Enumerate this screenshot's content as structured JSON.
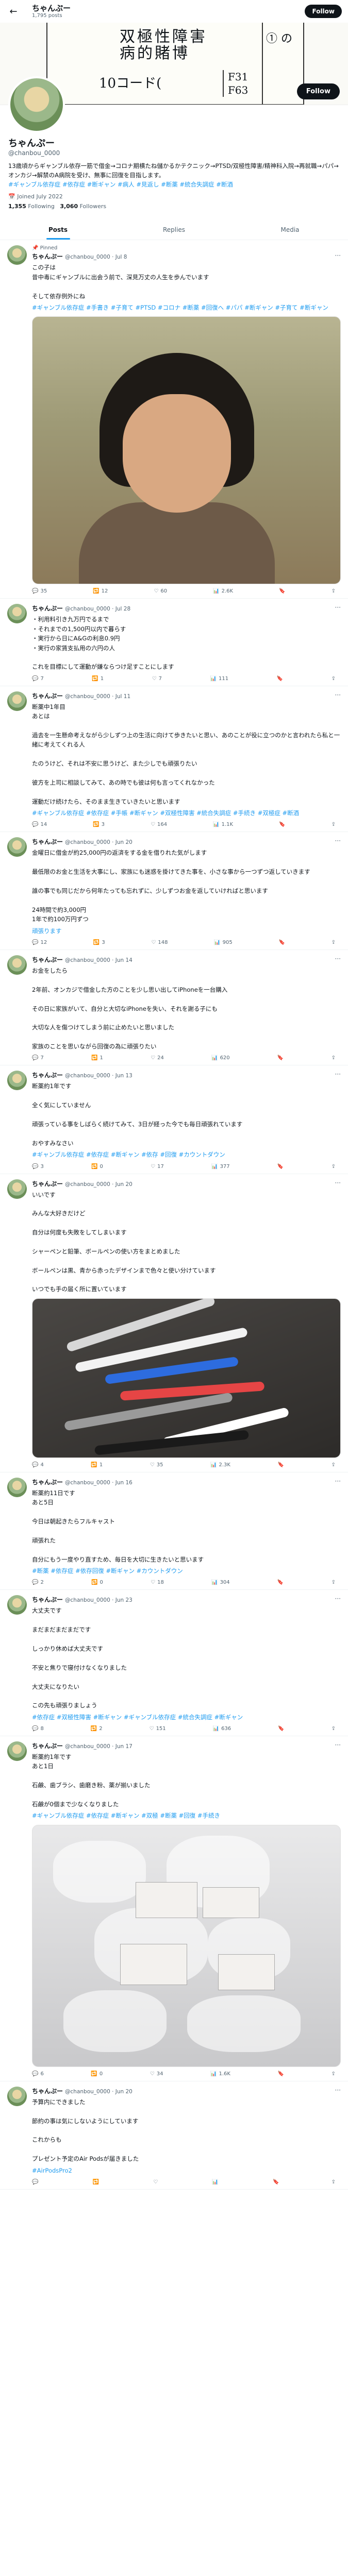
{
  "header": {
    "back_icon": "arrow-left-icon",
    "name": "ちゃんぷー",
    "posts_count": "1,795 posts",
    "follow": "Follow"
  },
  "banner": {
    "line1": "双極性障害",
    "line2": "病的賭博",
    "code": "10コード(",
    "f1": "F31",
    "f2": "F63",
    "right": "① の"
  },
  "profile": {
    "name": "ちゃんぷー",
    "handle": "@chanbou_0000",
    "bio": "13歳頃からギャンブル依存一筋で借金→コロナ期横たね儲かるかテクニック→PTSD/双極性障害/精神科入院→再就職→パパ→オンカジ→解禁のA病院を受け、無事に回復を目指します。",
    "tags": "#ギャンブル依存症 #依存症 #断ギャン #病人 #見返し #断薬 #統合失調症 #断酒",
    "joined": "Joined July 2022",
    "following": "1,355",
    "following_label": "Following",
    "followers": "3,060",
    "followers_label": "Followers",
    "follow": "Follow"
  },
  "tabs": [
    "Posts",
    "Replies",
    "Media"
  ],
  "tweets": [
    {
      "pinned": "Pinned",
      "name": "ちゃんぷー",
      "meta": "@chanbou_0000 · Jul 8",
      "text": "この子は\n昔中毒にギャンブルに出会う前で、深見万丈の人生を歩んでいます\n\nそして依存例外にね",
      "tags": "#ギャンブル依存症 #手書き #子育て #PTSD #コロナ #断薬 #回復へ #パパ #断ギャン #子育て #断ギャン",
      "stats": [
        "35",
        "12",
        "60",
        "2.6K"
      ]
    },
    {
      "name": "ちゃんぷー",
      "meta": "@chanbou_0000 · Jul 28",
      "text": "・利用料引き九万円でるまで\n・それまでの1,500円以内で暮らす\n・実行から日にA&Gの利息0.9円\n・実行の家賃支払用の六円の人\n\nこれを目標にして運動が嫌ならつけ足すことにします",
      "tags": "",
      "stats": [
        "7",
        "1",
        "7",
        "111"
      ]
    },
    {
      "name": "ちゃんぷー",
      "meta": "@chanbou_0000 · Jul 11",
      "text": "断薬中1年目\nあとは\n\n過去を一生懸命考えながら少しずつ上の生活に向けて歩きたいと思い、あのことが役に立つのかと言われたら私と一緒に考えてくれる人\n\nたのうけど、それは不安に思うけど、また少しでも頑張りたい\n\n彼方を上司に相談してみて、あの時でも彼は何も言ってくれなかった\n\n運動だけ続けたら、そのまま生きていきたいと思います",
      "tags": "#ギャンブル依存症 #依存症 #手帳 #断ギャン #双極性障害 #統合失調症 #手続き #双極症 #断酒",
      "stats": [
        "14",
        "3",
        "164",
        "1.1K"
      ]
    },
    {
      "name": "ちゃんぷー",
      "meta": "@chanbou_0000 · Jun 20",
      "text": "金曜日に借金が約25,000円の返済をする金を借りれた気がします\n\n最低限のお金と生活を大事にし、家族にも迷惑を掛けてきた事を、小さな事から一つずつ返していきます\n\n誰の事でも同じだから何年たっても忘れずに、少しずつお金を返していければと思います\n\n24時間で約3,000円\n1年で約100万円ずつ",
      "tags": "頑張ります",
      "stats": [
        "12",
        "3",
        "148",
        "905"
      ]
    },
    {
      "name": "ちゃんぷー",
      "meta": "@chanbou_0000 · Jun 14",
      "text": "お金をしたら\n\n2年前、オンカジで借金した方のことを少し思い出してiPhoneを一台購入\n\nその日に家族がいて、自分と大切なiPhoneを失い、それを謝る子にも\n\n大切な人を傷つけてしまう前に止めたいと思いました\n\n家族のことを思いながら回復の為に頑張りたい",
      "tags": "",
      "stats": [
        "7",
        "1",
        "24",
        "620"
      ]
    },
    {
      "name": "ちゃんぷー",
      "meta": "@chanbou_0000 · Jun 13",
      "text": "断薬約1年です\n\n全く気にしていません\n\n頑張っている事をしばらく続けてみて、3日が経った今でも毎日頑張れています\n\nおやすみなさい",
      "tags": "#ギャンブル依存症 #依存症 #断ギャン #依存 #回復 #カウントダウン",
      "stats": [
        "3",
        "0",
        "17",
        "377"
      ]
    },
    {
      "name": "ちゃんぷー",
      "meta": "@chanbou_0000 · Jun 20",
      "text": "いいです\n\nみんな大好きだけど\n\n自分は何度も失敗をしてしまいます\n\nシャーペンと鉛筆、ボールペンの使い方をまとめました\n\nボールペンは黒、青から赤ったデザインまで色々と使い分けています\n\nいつでも手の届く所に置いています",
      "tags": "",
      "stats": [
        "4",
        "1",
        "35",
        "2.3K"
      ]
    },
    {
      "name": "ちゃんぷー",
      "meta": "@chanbou_0000 · Jun 16",
      "text": "断薬約11日です\nあと5日\n\n今日は朝起きたらフルキャスト\n\n頑張れた\n\n自分にもう一度やり直すため、毎日を大切に生きたいと思います",
      "tags": "#断薬 #依存症 #依存回復 #断ギャン #カウントダウン",
      "stats": [
        "2",
        "0",
        "18",
        "304"
      ]
    },
    {
      "name": "ちゃんぷー",
      "meta": "@chanbou_0000 · Jun 23",
      "text": "大丈夫です\n\nまだまだまだまだです\n\nしっかり休めば大丈夫です\n\n不安と焦りで寝付けなくなりました\n\n大丈夫になりたい\n\nこの先も頑張りましょう",
      "tags": "#依存症 #双極性障害 #断ギャン #ギャンブル依存症 #統合失調症 #断ギャン",
      "stats": [
        "8",
        "2",
        "151",
        "636"
      ]
    },
    {
      "name": "ちゃんぷー",
      "meta": "@chanbou_0000 · Jun 17",
      "text": "断薬約1年です\nあと1日\n\n石鹸、歯ブラシ、歯磨き粉、薬が揃いました\n\n石鹸が0個まで少なくなりました",
      "tags": "#ギャンブル依存症 #依存症 #断ギャン #双極 #断薬 #回復 #手続き",
      "stats": [
        "6",
        "0",
        "34",
        "1.6K"
      ]
    },
    {
      "name": "ちゃんぷー",
      "meta": "@chanbou_0000 · Jun 20",
      "text": "予算内にできました\n\n節約の事は気にしないようにしています\n\nこれからも\n\nプレゼント予定のAir Podsが届きました",
      "tags": "#AirPodsPro2",
      "stats": [
        "",
        "",
        "",
        ""
      ]
    }
  ],
  "colors": {
    "accent": "#1d9bf0",
    "text": "#0f1419",
    "muted": "#536471"
  }
}
